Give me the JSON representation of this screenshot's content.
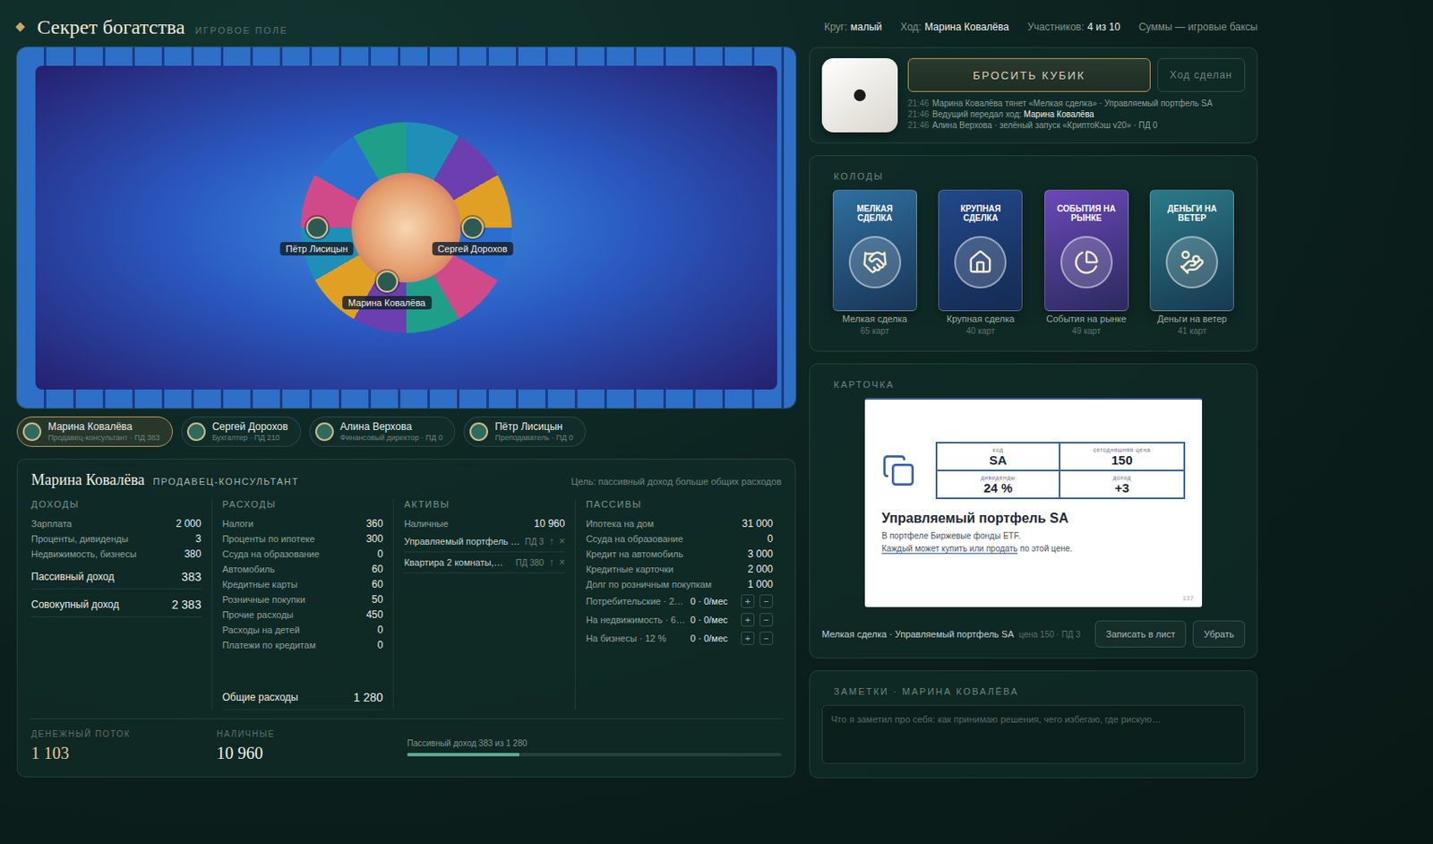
{
  "header": {
    "title": "Секрет богатства",
    "subtitle": "ИГРОВОЕ ПОЛЕ",
    "meta": [
      {
        "label": "Круг:",
        "value": "малый"
      },
      {
        "label": "Ход:",
        "value": "Марина Ковалёва"
      },
      {
        "label": "Участников:",
        "value": "4 из 10"
      },
      {
        "label": "Суммы — игровые баксы",
        "value": ""
      }
    ]
  },
  "board": {
    "tokens": [
      {
        "name": "Пётр Лисицын"
      },
      {
        "name": "Сергей Дорохов"
      },
      {
        "name": "Марина Ковалёва"
      }
    ]
  },
  "players": [
    {
      "name": "Марина Ковалёва",
      "info": "Продавец-консультант · ПД 383",
      "selected": true
    },
    {
      "name": "Сергей Дорохов",
      "info": "Бухгалтер · ПД 210",
      "selected": false
    },
    {
      "name": "Алина Верхова",
      "info": "Финансовый директор · ПД 0",
      "selected": false
    },
    {
      "name": "Пётр Лисицын",
      "info": "Преподаватель · ПД 0",
      "selected": false
    }
  ],
  "turn": {
    "dice": {
      "pips": 1
    },
    "roll_button": {
      "label": "БРОСИТЬ КУБИК",
      "disabled": false
    },
    "done_button": {
      "label": "Ход сделан",
      "disabled": true
    },
    "log": [
      {
        "time": "21:46",
        "text": "Марина Ковалёва тянет «Мелкая сделка» · Управляемый портфель SA",
        "accent": ""
      },
      {
        "time": "21:46",
        "text": "Ведущий передал ход: ",
        "accent": "Марина Ковалёва"
      },
      {
        "time": "21:46",
        "text": "Алина Верхова · зелёный запуск «КриптоКэш v20» · ПД 0",
        "accent": ""
      }
    ]
  },
  "decks": {
    "title": "КОЛОДЫ",
    "items": [
      {
        "art_title": "МЕЛКАЯ СДЕЛКА",
        "name": "Мелкая сделка",
        "count": "65 карт",
        "color": "#2f6f9e"
      },
      {
        "art_title": "КРУПНАЯ СДЕЛКА",
        "name": "Крупная сделка",
        "count": "40 карт",
        "color": "#22488a"
      },
      {
        "art_title": "СОБЫТИЯ НА РЫНКЕ",
        "name": "События на рынке",
        "count": "49 карт",
        "color": "#6b48b8"
      },
      {
        "art_title": "ДЕНЬГИ НА ВЕТЕР",
        "name": "Деньги на ветер",
        "count": "41 карт",
        "color": "#2b7a88"
      }
    ]
  },
  "card": {
    "title": "КАРТОЧКА",
    "cells": [
      {
        "label": "код",
        "value": "SA"
      },
      {
        "label": "сегодняшняя цена",
        "value": "150"
      },
      {
        "label": "дивиденды",
        "value": "24 %"
      },
      {
        "label": "доход",
        "value": "+3"
      }
    ],
    "name": "Управляемый портфель SA",
    "description": "В портфеле Биржевые фонды ETF.",
    "rule_underlined": "Каждый может купить или продать",
    "rule_rest": " по этой цене.",
    "number": "137",
    "footer": {
      "text": "Мелкая сделка · Управляемый портфель SA",
      "meta": "цена 150 · ПД 3"
    },
    "buttons": [
      "Записать в лист",
      "Убрать"
    ]
  },
  "notes": {
    "title": "ЗАМЕТКИ · МАРИНА КОВАЛЁВА",
    "placeholder": "Что я заметил про себя: как принимаю решения, чего избегаю, где рискую…"
  },
  "sheet": {
    "name": "Марина Ковалёва",
    "role": "ПРОДАВЕЦ-КОНСУЛЬТАНТ",
    "goal": "Цель: пассивный доход больше общих расходов",
    "incomes": {
      "title": "ДОХОДЫ",
      "rows": [
        {
          "label": "Зарплата",
          "value": "2 000",
          "kind": "item"
        },
        {
          "label": "Проценты, дивиденды",
          "value": "3",
          "kind": "item"
        },
        {
          "label": "Недвижимость, бизнесы",
          "value": "380",
          "kind": "item"
        },
        {
          "label": "Пассивный доход",
          "value": "383",
          "kind": "total"
        },
        {
          "label": "Совокупный доход",
          "value": "2 383",
          "kind": "total"
        }
      ]
    },
    "expenses": {
      "title": "РАСХОДЫ",
      "rows": [
        {
          "label": "Налоги",
          "value": "360"
        },
        {
          "label": "Проценты по ипотеке",
          "value": "300"
        },
        {
          "label": "Ссуда на образование",
          "value": "0"
        },
        {
          "label": "Автомобиль",
          "value": "60"
        },
        {
          "label": "Кредитные карты",
          "value": "60"
        },
        {
          "label": "Розничные покупки",
          "value": "50"
        },
        {
          "label": "Прочие расходы",
          "value": "450"
        },
        {
          "label": "Расходы на детей",
          "value": "0"
        },
        {
          "label": "Платежи по кредитам",
          "value": "0"
        }
      ],
      "total": {
        "label": "Общие расходы",
        "value": "1 280"
      }
    },
    "assets": {
      "title": "АКТИВЫ",
      "cash": {
        "label": "Наличные",
        "value": "10 960"
      },
      "rows": [
        {
          "label": "Управляемый портфель …",
          "pd": "ПД 3",
          "up": "↑",
          "remove": "×"
        },
        {
          "label": "Квартира 2 комнаты,…",
          "pd": "ПД 380",
          "up": "↑",
          "remove": "×"
        }
      ]
    },
    "liabilities": {
      "title": "ПАССИВЫ",
      "rows": [
        {
          "label": "Ипотека на дом",
          "value": "31 000"
        },
        {
          "label": "Ссуда на образование",
          "value": "0"
        },
        {
          "label": "Кредит на автомобиль",
          "value": "3 000"
        },
        {
          "label": "Кредитные карточки",
          "value": "2 000"
        },
        {
          "label": "Долг по розничным покупкам",
          "value": "1 000"
        }
      ],
      "loans": [
        {
          "label": "Потребительские · 2…",
          "value": "0 · 0/мес",
          "plus": "+",
          "minus": "−"
        },
        {
          "label": "На недвижимость · 6…",
          "value": "0 · 0/мес",
          "plus": "+",
          "minus": "−"
        },
        {
          "label": "На бизнесы · 12 %",
          "value": "0 · 0/мес",
          "plus": "+",
          "minus": "−"
        }
      ]
    },
    "cashflow": {
      "label": "ДЕНЕЖНЫЙ ПОТОК",
      "value": "1 103"
    },
    "cash": {
      "label": "НАЛИЧНЫЕ",
      "value": "10 960"
    },
    "progress": {
      "label": "Пассивный доход 383 из 1 280",
      "level": 0.3
    }
  }
}
